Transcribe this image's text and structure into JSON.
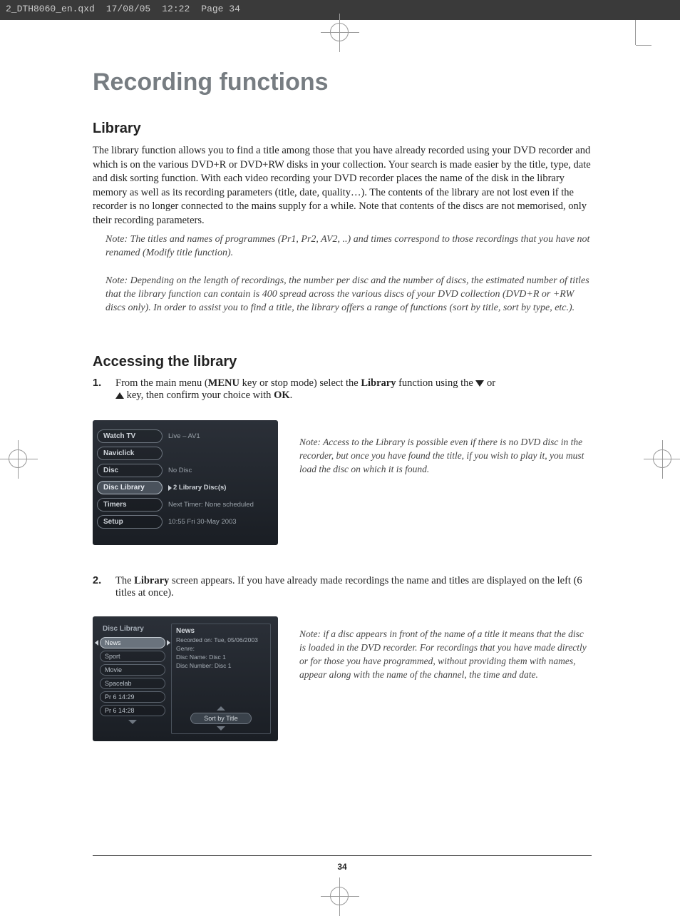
{
  "topHeader": {
    "filename": "2_DTH8060_en.qxd",
    "date": "17/08/05",
    "time": "12:22",
    "pageLabel": "Page 34"
  },
  "mainTitle": "Recording functions",
  "librarySection": {
    "heading": "Library",
    "body": "The library function allows you to find a title among those that you have already recorded using your DVD recorder and which is on the various DVD+R or DVD+RW disks in your collection. Your search is made easier by the title, type, date and disk sorting function.  With each video recording your DVD recorder places the name of the disk in the library memory as well as its recording parameters (title, date, quality…). The contents of the library are not lost even if the recorder is no longer connected to the mains supply for a while. Note that contents of the discs are not memorised, only their recording parameters.",
    "note1": "Note: The titles and names of programmes (Pr1, Pr2, AV2, ..) and times correspond to those recordings that you have not renamed (Modify title function).",
    "note2": "Note: Depending on the length of recordings, the number per disc and the number of discs, the estimated number of titles that the library function can contain is 400 spread across the various discs of your DVD collection (DVD+R or +RW discs only). In order to assist you to find a title, the library offers a range of functions (sort by title, sort by type, etc.)."
  },
  "accessingSection": {
    "heading": "Accessing the library",
    "step1": {
      "num": "1.",
      "text_a": "From the main menu (",
      "menu_bold": "MENU",
      "text_b": " key or stop mode) select the ",
      "library_bold": "Library",
      "text_c": " function using the ",
      "text_d": " or ",
      "text_e": " key, then confirm your choice with ",
      "ok_bold": "OK",
      "text_f": "."
    },
    "sideNote1": "Note: Access to the Library is possible even if there is no DVD disc in the recorder, but once you have found the title, if you wish to play it, you must load the disc on which it is found.",
    "step2": {
      "num": "2.",
      "text_a": "The ",
      "library_bold": "Library",
      "text_b": " screen appears. If you have already made recordings the name and titles are displayed on the left (6 titles at once)."
    },
    "sideNote2": "Note: if a disc appears in front of the name of a title it means that the disc is loaded in the  DVD recorder. For recordings that you have made directly or for those you have programmed, without providing them with names, appear along with the name of the channel, the time and date."
  },
  "deviceMenu1": {
    "items": [
      {
        "label": "Watch TV",
        "value": "Live – AV1",
        "selected": false
      },
      {
        "label": "Naviclick",
        "value": "",
        "selected": false
      },
      {
        "label": "Disc",
        "value": "No Disc",
        "selected": false
      },
      {
        "label": "Disc Library",
        "value": "2 Library Disc(s)",
        "selected": true
      },
      {
        "label": "Timers",
        "value": "Next Timer: None scheduled",
        "selected": false
      },
      {
        "label": "Setup",
        "value": "10:55 Fri 30-May 2003",
        "selected": false
      }
    ]
  },
  "deviceMenu2": {
    "title": "Disc Library",
    "leftItems": [
      "News",
      "Sport",
      "Movie",
      "Spacelab",
      "Pr 6 14:29",
      "Pr 6 14:28"
    ],
    "selectedIndex": 0,
    "info": {
      "title": "News",
      "recorded": "Recorded on: Tue, 05/06/2003",
      "genre": "Genre:",
      "discName": "Disc Name: Disc 1",
      "discNumber": "Disc Number: Disc 1"
    },
    "sortButton": "Sort by Title"
  },
  "pageNumber": "34"
}
